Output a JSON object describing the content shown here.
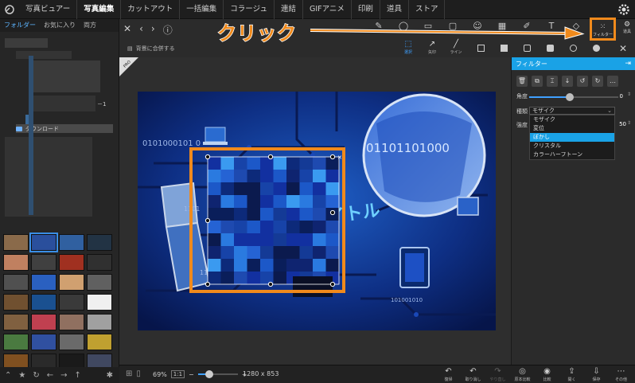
{
  "menubar": {
    "items": [
      "写真ビュアー",
      "写真編集",
      "カットアウト",
      "一括編集",
      "コラージュ",
      "連結",
      "GIFアニメ",
      "印刷",
      "道具",
      "ストア"
    ],
    "active_index": 1
  },
  "left_panel": {
    "tabs": [
      "フォルダー",
      "お気に入り",
      "両方"
    ],
    "tree": {
      "nodes": [
        {
          "label": "ダウンロード",
          "selected": true
        }
      ],
      "partial_text": "－1"
    },
    "thumbnail_count": 32,
    "thumbnail_colors": [
      "#8a6a4a",
      "#2a4f9c",
      "#3060a0",
      "#223344",
      "#c08060",
      "#404040",
      "#a03020",
      "#303030",
      "#505050",
      "#2a60c0",
      "#d0a070",
      "#606060",
      "#705030",
      "#1a5090",
      "#3a3a3a",
      "#f0f0f0",
      "#806040",
      "#c04050",
      "#907060",
      "#a0a0a0",
      "#4a7a40",
      "#3050a0",
      "#6a6a6a",
      "#c0a030",
      "#805020",
      "#2a2a2a",
      "#1a1a1a",
      "#404860",
      "#a05030",
      "#6080a0",
      "#303030",
      "#606060"
    ],
    "bottom_icons": [
      "chevron-up",
      "star",
      "refresh",
      "back",
      "forward",
      "up",
      "gear"
    ]
  },
  "toolbar": {
    "background_merge_label": "背景に合併する",
    "sub_tools": [
      {
        "label": "選択",
        "selected": true
      },
      {
        "label": "矢印",
        "selected": false
      },
      {
        "label": "ライン",
        "selected": false
      }
    ],
    "filter_label": "フィルター",
    "tool_label_right": "道具"
  },
  "annotation": {
    "text": "クリック",
    "color": "#f08a1c"
  },
  "canvas": {
    "pro_badge": "PRO",
    "image_text": [
      "0101000101 0",
      "01101101000",
      "1101",
      "11",
      "101001010",
      "イトル"
    ]
  },
  "filter_panel": {
    "title": "フィルター",
    "angle_label": "角度",
    "angle_value": "0",
    "type_label": "種類",
    "type_value": "モザイク",
    "strength_label": "強度",
    "strength_value": "50",
    "options": [
      "モザイク",
      "変位",
      "ぼかし",
      "クリスタル",
      "カラーハーフトーン"
    ],
    "selected_option_index": 2
  },
  "bottombar": {
    "zoom": "69%",
    "ratio_button": "1:1",
    "zoom_level": 0.28,
    "dimensions": "1280 x 853",
    "actions": [
      {
        "label": "復帰",
        "enabled": true
      },
      {
        "label": "取り消し",
        "enabled": true
      },
      {
        "label": "やり直し",
        "enabled": false
      },
      {
        "label": "原本比較",
        "enabled": true
      },
      {
        "label": "比較",
        "enabled": true
      },
      {
        "label": "開く",
        "enabled": true
      },
      {
        "label": "保存",
        "enabled": true
      },
      {
        "label": "その他",
        "enabled": true
      }
    ]
  },
  "colors": {
    "accent": "#1aa2e6",
    "highlight_orange": "#f08a1c"
  }
}
